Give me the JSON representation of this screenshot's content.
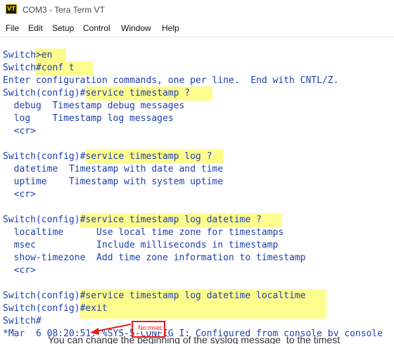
{
  "window": {
    "title": "COM3 - Tera Term VT",
    "icon": "VT"
  },
  "menu": [
    "File",
    "Edit",
    "Setup",
    "Control",
    "Window",
    "Help"
  ],
  "terminal": {
    "lines": [
      "Switch>en",
      "Switch#conf t",
      "Enter configuration commands, one per line.  End with CNTL/Z.",
      "Switch(config)#service timestamp ?",
      "  debug  Timestamp debug messages",
      "  log    Timestamp log messages",
      "  <cr>",
      "",
      "Switch(config)#service timestamp log ?",
      "  datetime  Timestamp with date and time",
      "  uptime    Timestamp with system uptime",
      "  <cr>",
      "",
      "Switch(config)#service timestamp log datetime ?",
      "  localtime      Use local time zone for timestamps",
      "  msec           Include milliseconds in timestamp",
      "  show-timezone  Add time zone information to timestamp",
      "  <cr>",
      "",
      "Switch(config)#service timestamp log datetime localtime",
      "Switch(config)#exit",
      "Switch#",
      "*Mar  6 08:20:51: %SYS-5-CONFIG_I: Configured from console by console"
    ]
  },
  "annotation": {
    "text": "No msec",
    "color": "#e41c1c"
  },
  "background_text": "You can change the beginning of the syslog message  to the timest",
  "colors": {
    "terminal_text": "#1e3fae",
    "highlight": "#fdfd8e",
    "annotation": "#e41c1c"
  }
}
